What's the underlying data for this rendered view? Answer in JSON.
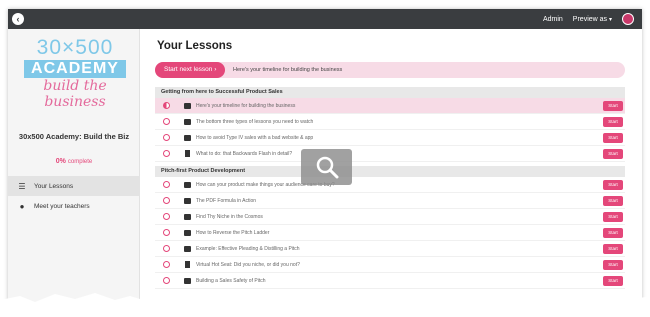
{
  "topbar": {
    "back_icon": "back-arrow-icon",
    "admin_label": "Admin",
    "preview_label": "Preview as",
    "accent": "#3a3d40"
  },
  "sidebar": {
    "logo": {
      "top": "30×500",
      "middle": "ACADEMY",
      "bottom": "build the business"
    },
    "course_title": "30x500 Academy: Build the Biz",
    "progress_value": "0%",
    "progress_label": "complete",
    "items": [
      {
        "label": "Your Lessons",
        "icon": "list-icon",
        "active": true
      },
      {
        "label": "Meet your teachers",
        "icon": "user-icon",
        "active": false
      }
    ]
  },
  "main": {
    "title": "Your Lessons",
    "next_button": "Start next lesson ›",
    "next_description": "Here's your timeline for building the business",
    "start_label": "Start",
    "sections": [
      {
        "title": "Getting from here to Successful Product Sales",
        "lessons": [
          {
            "title": "Here's your timeline for building the business",
            "type": "video",
            "current": true
          },
          {
            "title": "The bottom three types of lessons you need to watch",
            "type": "video"
          },
          {
            "title": "How to avoid Type IV sales with a bad website & app",
            "type": "video"
          },
          {
            "title": "What to do: that Backwards Flash in detail?",
            "type": "doc"
          }
        ]
      },
      {
        "title": "Pitch-first Product Development",
        "lessons": [
          {
            "title": "How can your product make things your audience care to buy?",
            "type": "video"
          },
          {
            "title": "The PDF Formula in Action",
            "type": "video"
          },
          {
            "title": "Find Thy Niche in the Cosmos",
            "type": "video"
          },
          {
            "title": "How to Reverse the Pitch Ladder",
            "type": "video"
          },
          {
            "title": "Example: Effective Pleading & Distilling a Pitch",
            "type": "video"
          },
          {
            "title": "Virtual Hot Seat: Did you niche, or did you not?",
            "type": "doc"
          },
          {
            "title": "Building a Sales Safety of Pitch",
            "type": "video"
          }
        ]
      }
    ]
  },
  "zoom_icon": "magnifier-icon",
  "colors": {
    "brand_pink": "#e4477a",
    "brand_blue": "#7fc8e8",
    "highlight": "#f7dbe6"
  }
}
